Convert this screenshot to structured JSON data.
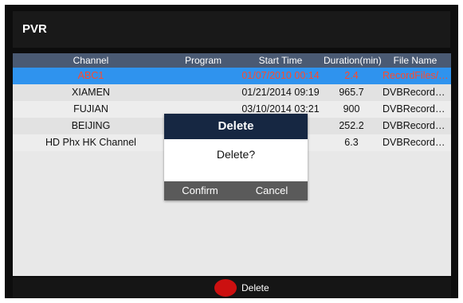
{
  "app": {
    "title": "PVR"
  },
  "table": {
    "columns": [
      "Channel",
      "Program",
      "Start Time",
      "Duration(min)",
      "File Name"
    ],
    "rows": [
      {
        "channel": "ABC1",
        "program": "",
        "start": "01/07/2010 00:14",
        "duration": "2.4",
        "file": "RecordFiles/REC_"
      },
      {
        "channel": "XIAMEN",
        "program": "",
        "start": "01/21/2014 09:19",
        "duration": "965.7",
        "file": "DVBRecordFiles/.."
      },
      {
        "channel": "FUJIAN",
        "program": "",
        "start": "03/10/2014 03:21",
        "duration": "900",
        "file": "DVBRecordFiles/.."
      },
      {
        "channel": "BEIJING",
        "program": "",
        "start": "",
        "duration": "252.2",
        "file": "DVBRecordFiles/.."
      },
      {
        "channel": "HD Phx HK Channel",
        "program": "",
        "start": "",
        "duration": "6.3",
        "file": "DVBRecordFiles/.."
      }
    ],
    "selected_index": 0
  },
  "dialog": {
    "title": "Delete",
    "message": "Delete?",
    "confirm": "Confirm",
    "cancel": "Cancel"
  },
  "bottom_bar": {
    "hint_label": "Delete",
    "hint_icon": "red-button-icon",
    "hint_color": "#cc1010"
  },
  "colors": {
    "header_bg": "#4a5a73",
    "selected_row": "#2f93ee",
    "selected_text": "#ff4a2a",
    "dialog_title_bg": "#162742"
  }
}
